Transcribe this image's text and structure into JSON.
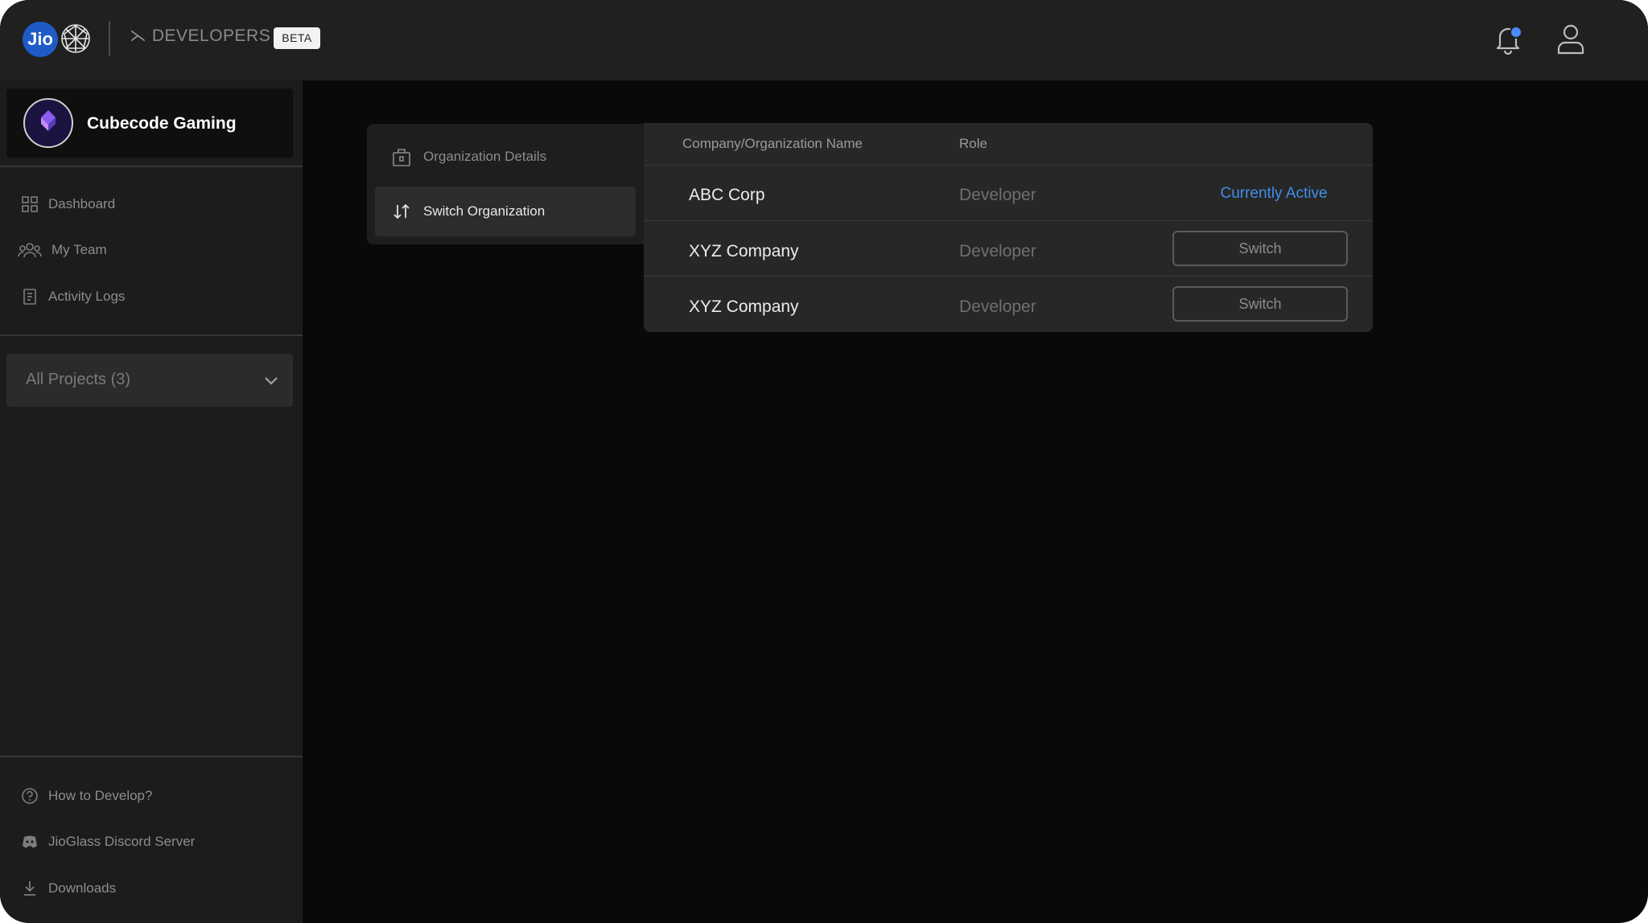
{
  "header": {
    "logo_text": "Jio",
    "developers_label": "⋋ DEVELOPERS",
    "beta_label": "BETA",
    "notification_icon": "bell-icon",
    "profile_icon": "user-icon",
    "accent_color": "#4a8cff"
  },
  "sidebar": {
    "org_name": "Cubecode Gaming",
    "nav_items": [
      {
        "label": "Dashboard",
        "icon": "grid-icon"
      },
      {
        "label": "My Team",
        "icon": "team-icon"
      },
      {
        "label": "Activity Logs",
        "icon": "logs-icon"
      }
    ],
    "projects_select": {
      "selected": "All Projects (3)"
    },
    "footer_items": [
      {
        "label": "How to Develop?",
        "icon": "help-icon"
      },
      {
        "label": "JioGlass Discord Server",
        "icon": "discord-icon"
      },
      {
        "label": "Downloads",
        "icon": "download-icon"
      }
    ]
  },
  "settings_nav": {
    "items": [
      {
        "label": "Organization Details",
        "icon": "building-icon",
        "active": false
      },
      {
        "label": "Switch Organization",
        "icon": "swap-arrows-icon",
        "active": true
      }
    ]
  },
  "org_table": {
    "columns": [
      "Company/Organization Name",
      "Role"
    ],
    "rows": [
      {
        "name": "ABC Corp",
        "role": "Developer",
        "status": "Currently Active"
      },
      {
        "name": "XYZ Company",
        "role": "Developer",
        "action": "Switch"
      },
      {
        "name": "XYZ Company",
        "role": "Developer",
        "action": "Switch"
      }
    ],
    "active_color": "#3f8ee8"
  }
}
